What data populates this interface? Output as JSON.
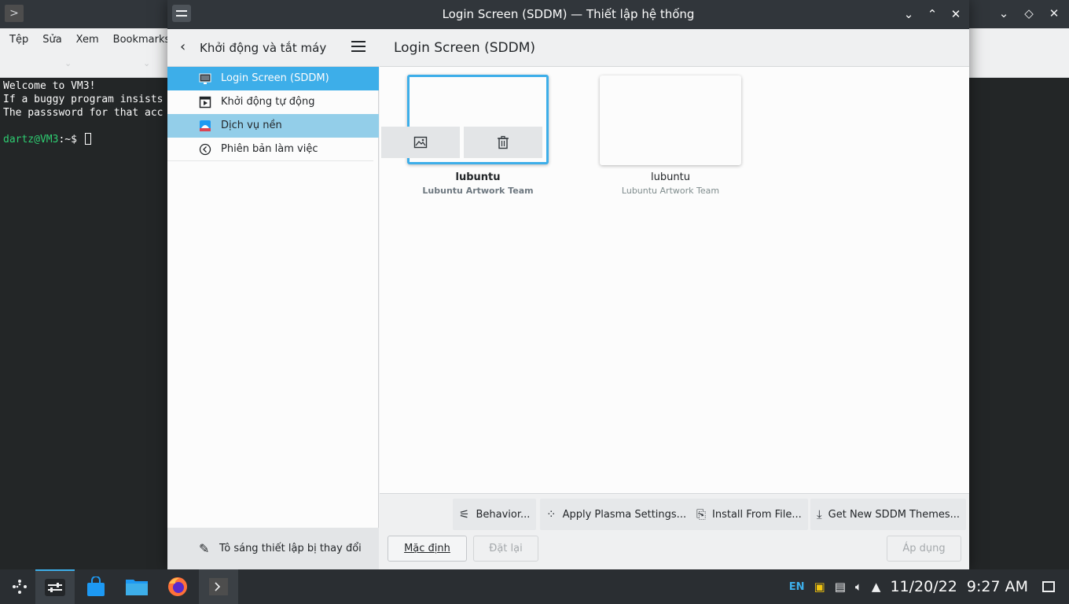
{
  "terminal": {
    "menu": [
      "Tệp",
      "Sửa",
      "Xem",
      "Bookmarks"
    ],
    "lines": [
      "Welcome to VM3!",
      "If a buggy program insists",
      "The passsword for that acc"
    ],
    "prompt_user": "dartz@VM3",
    "prompt_path": ":~$"
  },
  "window": {
    "title": "Login Screen (SDDM) — Thiết lập hệ thống",
    "controls": {
      "minimize": "⌄",
      "maximize": "⌃",
      "close": "✕"
    }
  },
  "sidebar": {
    "back_title": "Khởi động và tắt máy",
    "items": [
      {
        "label": "Login Screen (SDDM)",
        "icon": "monitor-icon",
        "state": "selected"
      },
      {
        "label": "Khởi động tự động",
        "icon": "autostart-icon",
        "state": "normal"
      },
      {
        "label": "Dịch vụ nền",
        "icon": "background-services-icon",
        "state": "hover"
      },
      {
        "label": "Phiên bản làm việc",
        "icon": "session-icon",
        "state": "normal"
      }
    ],
    "footer_label": "Tô sáng thiết lập bị thay đổi"
  },
  "main": {
    "title": "Login Screen (SDDM)",
    "themes": [
      {
        "name": "lubuntu",
        "author": "Lubuntu Artwork Team",
        "current": true
      },
      {
        "name": "lubuntu",
        "author": "Lubuntu Artwork Team",
        "current": false
      }
    ]
  },
  "toolbar": {
    "behavior": "Behavior...",
    "apply_plasma": "Apply Plasma Settings...",
    "install_from_file": "Install From File...",
    "get_new": "Get New SDDM Themes..."
  },
  "buttons": {
    "defaults": "Mặc định",
    "reset": "Đặt lại",
    "apply": "Áp dụng"
  },
  "taskbar": {
    "language": "EN",
    "date": "11/20/22",
    "time": "9:27 AM"
  },
  "colors": {
    "accent": "#3daee9",
    "selection_hover": "#93cee9",
    "titlebar": "#31363b",
    "terminal_bg": "#232627",
    "prompt_green": "#2ecc71"
  }
}
